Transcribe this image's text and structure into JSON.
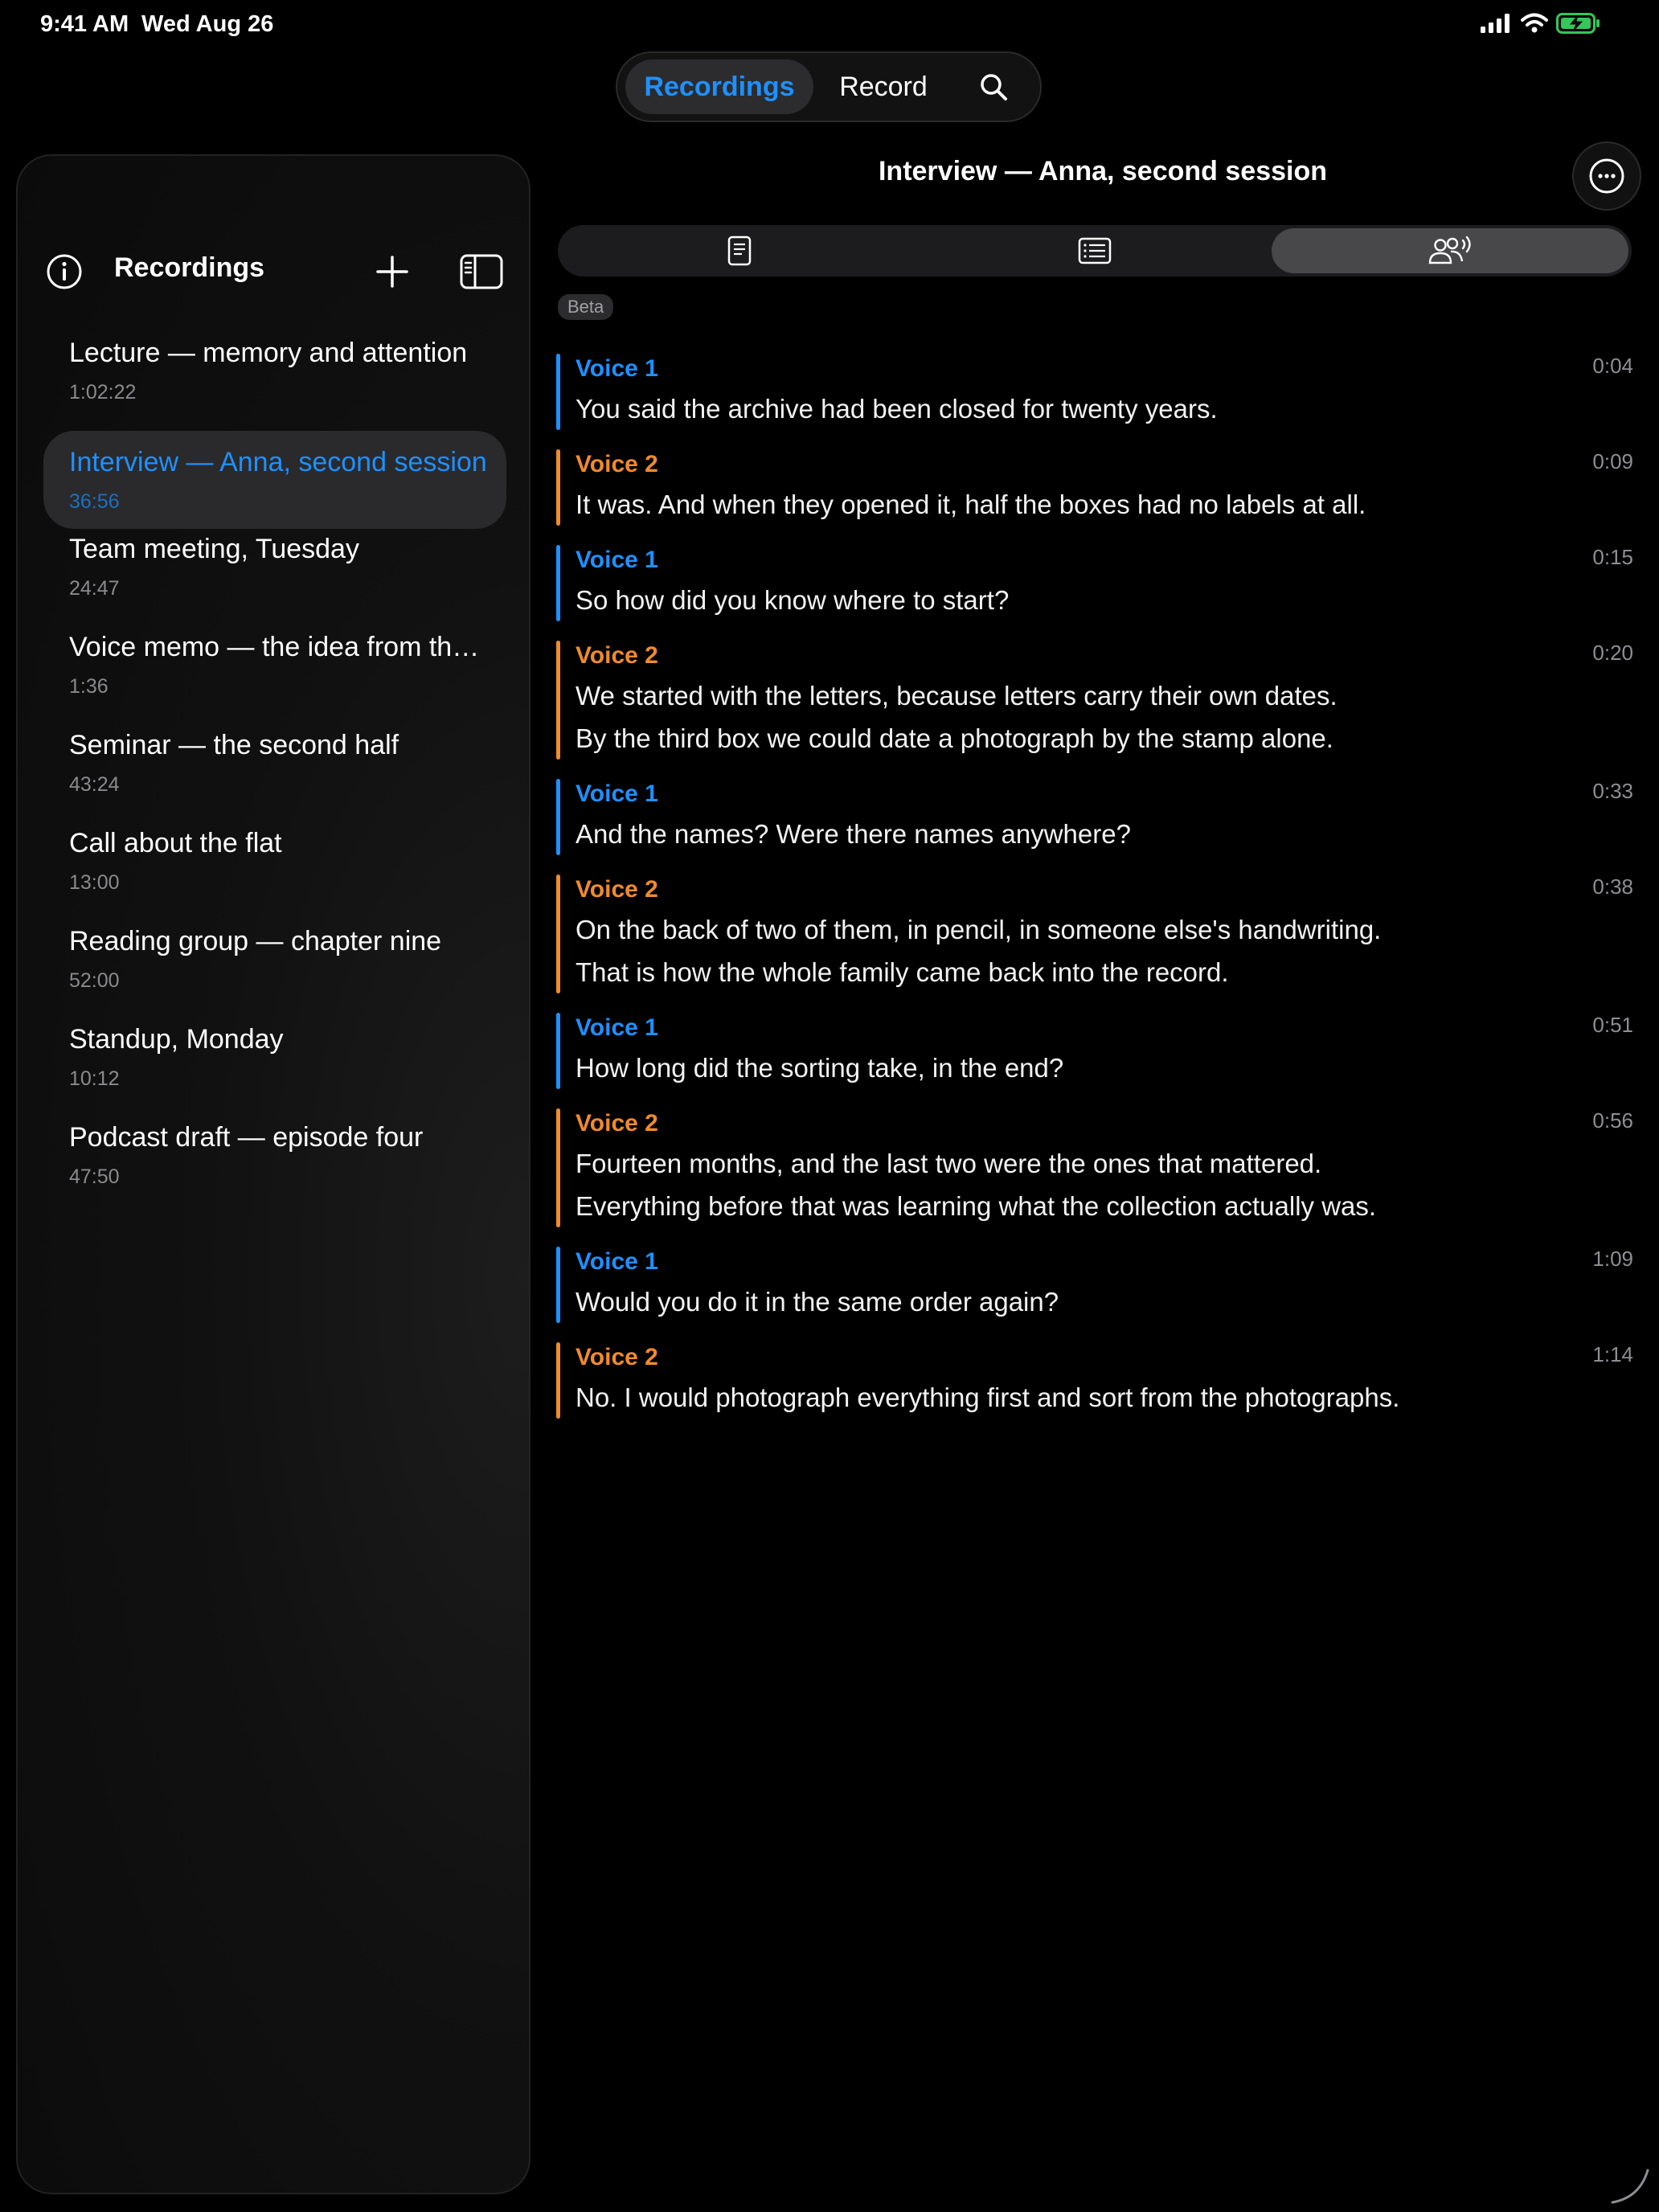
{
  "status_bar": {
    "time": "9:41 AM",
    "date": "Wed Aug 26"
  },
  "top_segment": {
    "tabs": [
      "Recordings",
      "Record"
    ],
    "selected": "Recordings"
  },
  "sidebar": {
    "title": "Recordings",
    "items": [
      {
        "title": "Lecture — memory and attention",
        "duration": "1:02:22"
      },
      {
        "title": "Interview — Anna, second session",
        "duration": "36:56",
        "selected": true
      },
      {
        "title": "Team meeting, Tuesday",
        "duration": "24:47"
      },
      {
        "title": "Voice memo — the idea from the train",
        "duration": "1:36"
      },
      {
        "title": "Seminar — the second half",
        "duration": "43:24"
      },
      {
        "title": "Call about the flat",
        "duration": "13:00"
      },
      {
        "title": "Reading group — chapter nine",
        "duration": "52:00"
      },
      {
        "title": "Standup, Monday",
        "duration": "10:12"
      },
      {
        "title": "Podcast draft — episode four",
        "duration": "47:50"
      }
    ]
  },
  "detail": {
    "title": "Interview — Anna, second session",
    "view_tabs": [
      "document-icon",
      "list-icon",
      "speakers-icon"
    ],
    "selected_view": 2,
    "badge": "Beta",
    "transcript": [
      {
        "speaker": "Voice 1",
        "time": "0:04",
        "lines": [
          "You said the archive had been closed for twenty years."
        ]
      },
      {
        "speaker": "Voice 2",
        "time": "0:09",
        "lines": [
          "It was. And when they opened it, half the boxes had no labels at all."
        ]
      },
      {
        "speaker": "Voice 1",
        "time": "0:15",
        "lines": [
          "So how did you know where to start?"
        ]
      },
      {
        "speaker": "Voice 2",
        "time": "0:20",
        "lines": [
          "We started with the letters, because letters carry their own dates.",
          "By the third box we could date a photograph by the stamp alone."
        ]
      },
      {
        "speaker": "Voice 1",
        "time": "0:33",
        "lines": [
          "And the names? Were there names anywhere?"
        ]
      },
      {
        "speaker": "Voice 2",
        "time": "0:38",
        "lines": [
          "On the back of two of them, in pencil, in someone else's handwriting.",
          "That is how the whole family came back into the record."
        ]
      },
      {
        "speaker": "Voice 1",
        "time": "0:51",
        "lines": [
          "How long did the sorting take, in the end?"
        ]
      },
      {
        "speaker": "Voice 2",
        "time": "0:56",
        "lines": [
          "Fourteen months, and the last two were the ones that mattered.",
          "Everything before that was learning what the collection actually was."
        ]
      },
      {
        "speaker": "Voice 1",
        "time": "1:09",
        "lines": [
          "Would you do it in the same order again?"
        ]
      },
      {
        "speaker": "Voice 2",
        "time": "1:14",
        "lines": [
          "No. I would photograph everything first and sort from the photographs."
        ]
      }
    ]
  },
  "colors": {
    "accent": "#1e90ff",
    "voice1": "#1e90ff",
    "voice2": "#f08a2c",
    "background": "#000000"
  }
}
